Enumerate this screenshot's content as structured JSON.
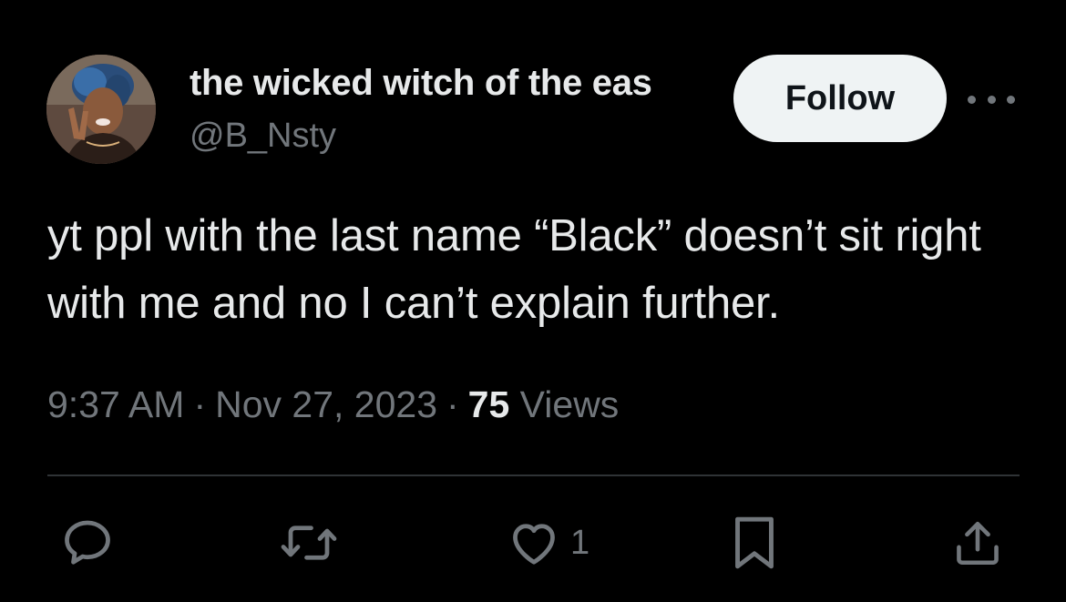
{
  "author": {
    "display_name": "the wicked witch of the eas",
    "handle": "@B_Nsty"
  },
  "header": {
    "follow_label": "Follow"
  },
  "tweet": {
    "text": "yt ppl with the last name “Black” doesn’t sit right with me and no I can’t explain further.",
    "time": "9:37 AM",
    "separator": "·",
    "date": "Nov 27, 2023",
    "views_count": "75",
    "views_label": "Views"
  },
  "actions": {
    "like_count": "1"
  },
  "icons": {
    "reply": "reply-icon",
    "retweet": "retweet-icon",
    "like": "heart-icon",
    "bookmark": "bookmark-icon",
    "share": "share-icon",
    "more": "more-options-icon"
  },
  "colors": {
    "background": "#000000",
    "primary_text": "#e7e9ea",
    "secondary_text": "#71767b",
    "divider": "#2f3336",
    "follow_bg": "#eff3f4",
    "follow_text": "#0f1419"
  }
}
